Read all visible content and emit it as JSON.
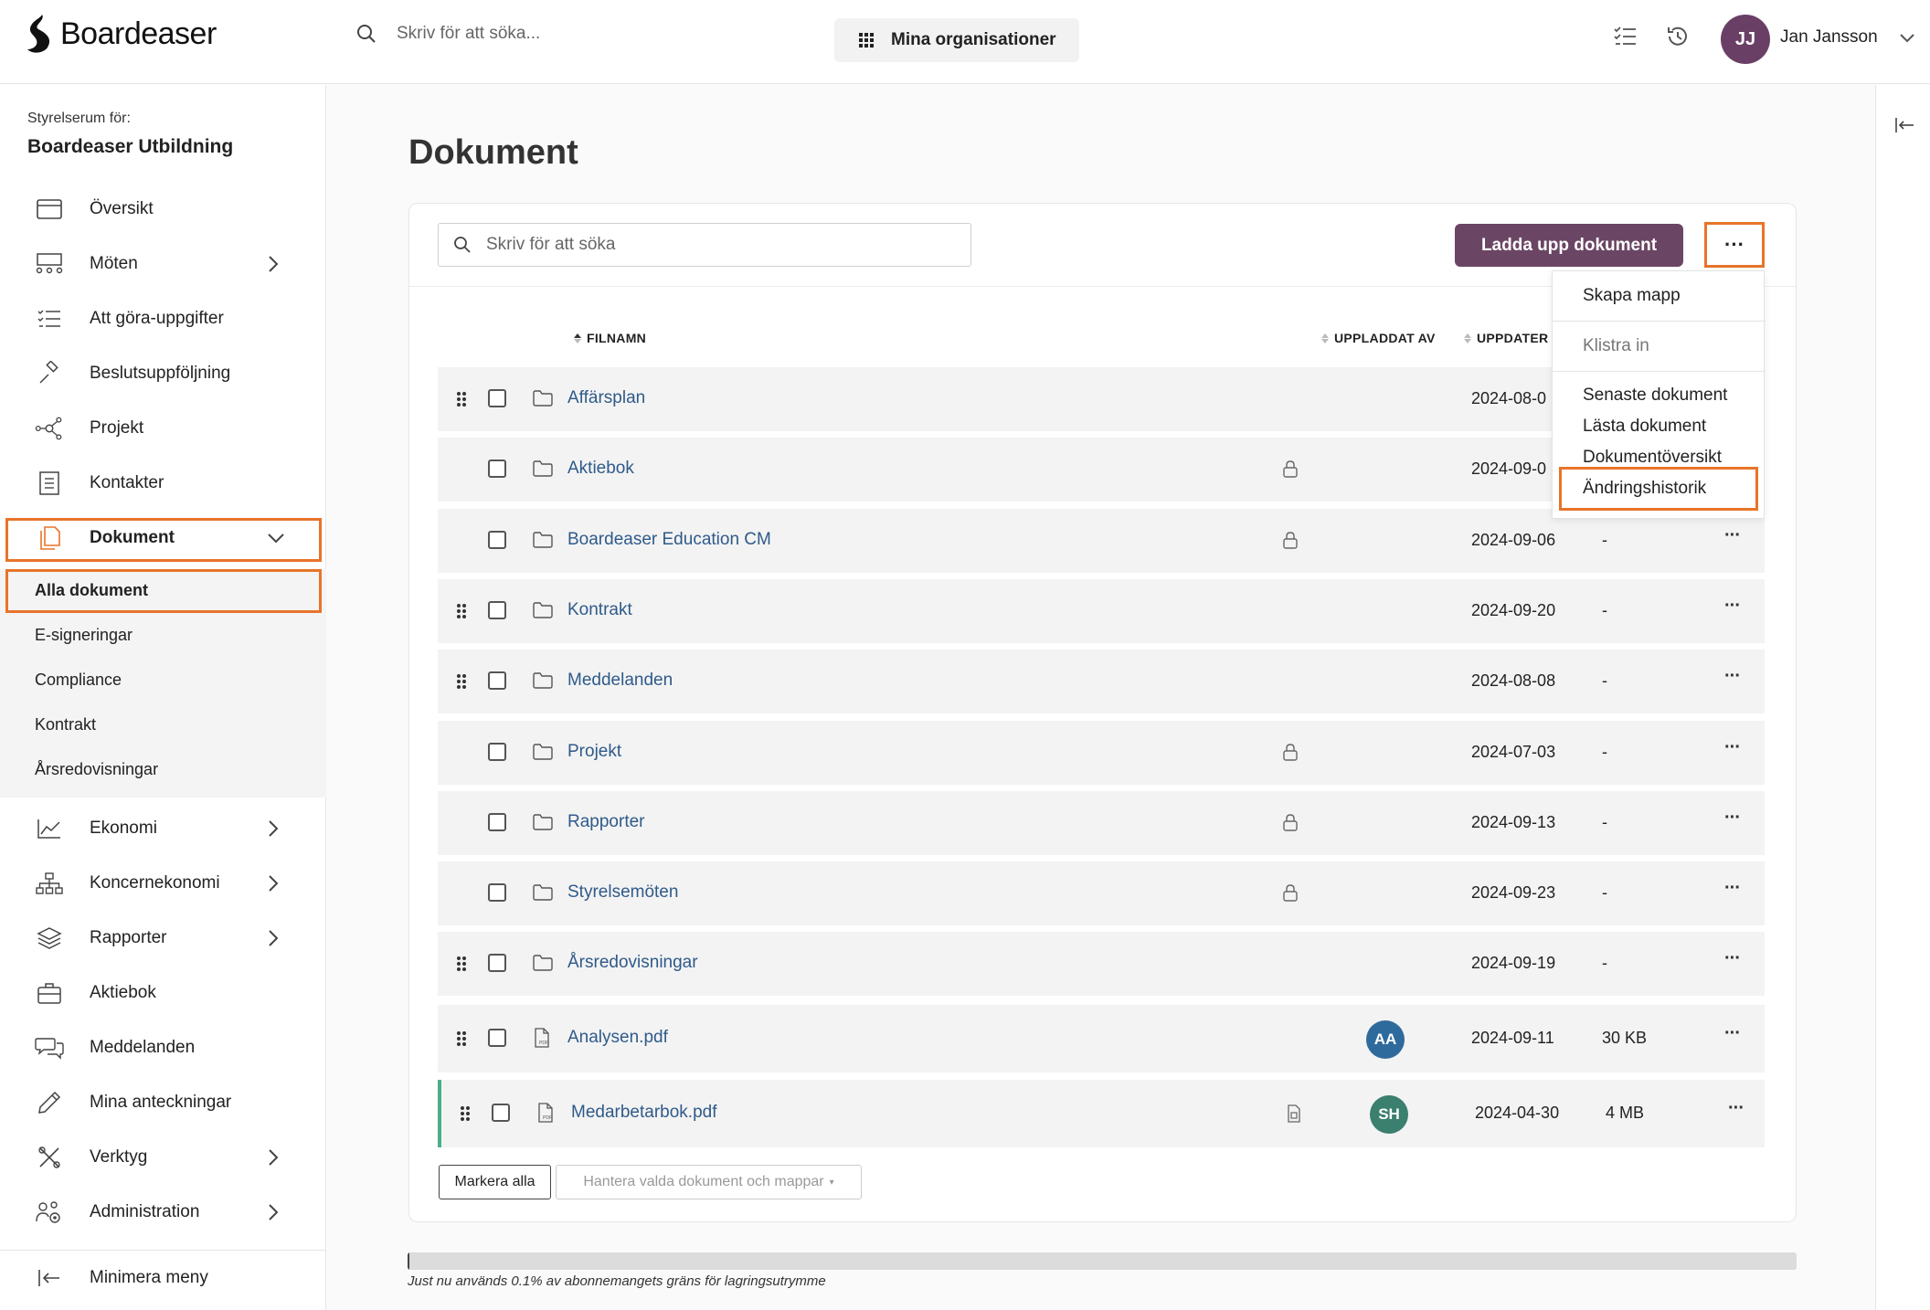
{
  "app": {
    "name": "Boardeaser"
  },
  "header": {
    "search_placeholder": "Skriv för att söka...",
    "org_button": "Mina organisationer",
    "user": {
      "initials": "JJ",
      "name": "Jan Jansson"
    }
  },
  "sidebar": {
    "context_label": "Styrelserum för:",
    "org_name": "Boardeaser Utbildning",
    "items": [
      {
        "label": "Översikt",
        "icon": "overview-icon",
        "chevron": false
      },
      {
        "label": "Möten",
        "icon": "meetings-icon",
        "chevron": true
      },
      {
        "label": "Att göra-uppgifter",
        "icon": "checklist-icon",
        "chevron": false
      },
      {
        "label": "Beslutsuppföljning",
        "icon": "gavel-icon",
        "chevron": false
      },
      {
        "label": "Projekt",
        "icon": "network-icon",
        "chevron": false
      },
      {
        "label": "Kontakter",
        "icon": "address-book-icon",
        "chevron": false
      },
      {
        "label": "Dokument",
        "icon": "documents-icon",
        "chevron": true,
        "expanded": true
      }
    ],
    "sub_items": [
      "Alla dokument",
      "E-signeringar",
      "Compliance",
      "Kontrakt",
      "Årsredovisningar"
    ],
    "items_after": [
      {
        "label": "Ekonomi",
        "icon": "line-chart-icon",
        "chevron": true
      },
      {
        "label": "Koncernekonomi",
        "icon": "org-chart-icon",
        "chevron": true
      },
      {
        "label": "Rapporter",
        "icon": "layers-icon",
        "chevron": true
      },
      {
        "label": "Aktiebok",
        "icon": "briefcase-icon",
        "chevron": false
      },
      {
        "label": "Meddelanden",
        "icon": "chat-icon",
        "chevron": false
      },
      {
        "label": "Mina anteckningar",
        "icon": "pencil-icon",
        "chevron": false
      },
      {
        "label": "Verktyg",
        "icon": "tools-icon",
        "chevron": true
      },
      {
        "label": "Administration",
        "icon": "users-gear-icon",
        "chevron": true
      }
    ],
    "minimize_label": "Minimera meny"
  },
  "main": {
    "title": "Dokument",
    "search_placeholder": "Skriv för att söka",
    "upload_button": "Ladda upp dokument",
    "more_button": "···",
    "columns": {
      "filename": "FILNAMN",
      "uploaded_by": "UPPLADDAT AV",
      "updated": "UPPDATER"
    },
    "rows": [
      {
        "name": "Affärsplan",
        "type": "folder",
        "drag": true,
        "lock": false,
        "date": "2024-08-0",
        "size": "",
        "avatar": "",
        "menu": false
      },
      {
        "name": "Aktiebok",
        "type": "folder",
        "drag": false,
        "lock": true,
        "date": "2024-09-0",
        "size": "",
        "avatar": "",
        "menu": false
      },
      {
        "name": "Boardeaser Education CM",
        "type": "folder",
        "drag": false,
        "lock": true,
        "date": "2024-09-06",
        "size": "-",
        "avatar": "",
        "menu": true
      },
      {
        "name": "Kontrakt",
        "type": "folder",
        "drag": true,
        "lock": false,
        "date": "2024-09-20",
        "size": "-",
        "avatar": "",
        "menu": true
      },
      {
        "name": "Meddelanden",
        "type": "folder",
        "drag": true,
        "lock": false,
        "date": "2024-08-08",
        "size": "-",
        "avatar": "",
        "menu": true
      },
      {
        "name": "Projekt",
        "type": "folder",
        "drag": false,
        "lock": true,
        "date": "2024-07-03",
        "size": "-",
        "avatar": "",
        "menu": true
      },
      {
        "name": "Rapporter",
        "type": "folder",
        "drag": false,
        "lock": true,
        "date": "2024-09-13",
        "size": "-",
        "avatar": "",
        "menu": true
      },
      {
        "name": "Styrelsemöten",
        "type": "folder",
        "drag": false,
        "lock": true,
        "date": "2024-09-23",
        "size": "-",
        "avatar": "",
        "menu": true
      },
      {
        "name": "Årsredovisningar",
        "type": "folder",
        "drag": true,
        "lock": false,
        "date": "2024-09-19",
        "size": "-",
        "avatar": "",
        "menu": true
      },
      {
        "name": "Analysen.pdf",
        "type": "pdf",
        "drag": true,
        "lock": false,
        "date": "2024-09-11",
        "size": "30 KB",
        "avatar": "AA",
        "avatar_color": "#2f6a9c",
        "menu": true
      },
      {
        "name": "Medarbetarbok.pdf",
        "type": "pdf",
        "drag": true,
        "lock": false,
        "doc_icon": true,
        "date": "2024-04-30",
        "size": "4 MB",
        "avatar": "SH",
        "avatar_color": "#3b7f6e",
        "menu": true
      }
    ],
    "dropdown": {
      "create_folder": "Skapa mapp",
      "paste": "Klistra in",
      "recent": "Senaste dokument",
      "read": "Lästa dokument",
      "overview": "Dokumentöversikt",
      "history": "Ändringshistorik"
    },
    "mark_all": "Markera alla",
    "manage_selected": "Hantera valda dokument och mappar",
    "storage": {
      "used_fraction": 0.001,
      "text": "Just nu används 0.1% av abonnemangets gräns för lagringsutrymme"
    }
  },
  "colors": {
    "accent": "#e8742a",
    "primary": "#6b4664",
    "link": "#2f5a8a"
  }
}
